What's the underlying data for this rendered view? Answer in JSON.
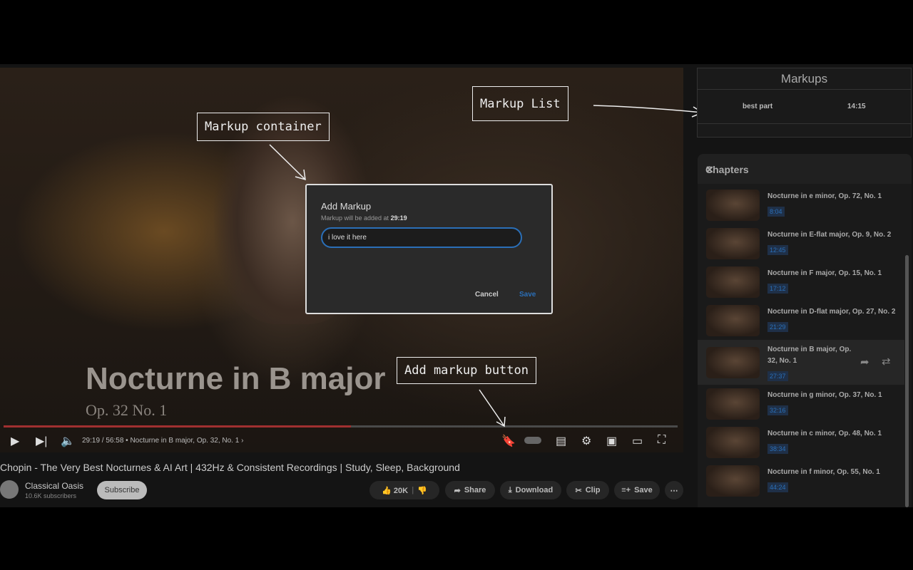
{
  "video": {
    "overlay_title": "Nocturne in B major",
    "overlay_subtitle": "Op. 32 No. 1",
    "progress_percent": 51.5,
    "time": "29:19 / 56:58",
    "chapter": "• Nocturne in B major, Op. 32, No. 1"
  },
  "dialog": {
    "title": "Add Markup",
    "hint": "Markup will be added at",
    "hint_time": "29:19",
    "input_value": "i love it here",
    "cancel": "Cancel",
    "save": "Save"
  },
  "annotations": {
    "markup_list": "Markup List",
    "markup_container": "Markup container",
    "add_markup_button": "Add markup button"
  },
  "info": {
    "title": "Chopin - The Very Best Nocturnes & AI Art | 432Hz & Consistent Recordings | Study, Sleep, Background",
    "channel": "Classical Oasis",
    "subscribers": "10.6K subscribers",
    "subscribe": "Subscribe",
    "likes": "20K",
    "share": "Share",
    "download": "Download",
    "clip": "Clip",
    "save": "Save"
  },
  "markups": {
    "title": "Markups",
    "items": [
      {
        "label": "best part",
        "time": "14:15"
      }
    ]
  },
  "chapters": {
    "title": "Chapters",
    "items": [
      {
        "name": "Nocturne in e minor, Op. 72, No. 1",
        "time": "8:04"
      },
      {
        "name": "Nocturne in E-flat major, Op. 9, No. 2",
        "time": "12:45"
      },
      {
        "name": "Nocturne in F major, Op. 15, No. 1",
        "time": "17:12"
      },
      {
        "name": "Nocturne in D-flat major, Op. 27, No. 2",
        "time": "21:29"
      },
      {
        "name": "Nocturne in B major, Op. 32, No. 1",
        "time": "27:37"
      },
      {
        "name": "Nocturne in g minor, Op. 37, No. 1",
        "time": "32:16"
      },
      {
        "name": "Nocturne in c minor, Op. 48, No. 1",
        "time": "38:34"
      },
      {
        "name": "Nocturne in f minor, Op. 55, No. 1",
        "time": "44:24"
      }
    ]
  },
  "colors": {
    "accent": "#2a6fb8",
    "progress": "#a03030"
  }
}
